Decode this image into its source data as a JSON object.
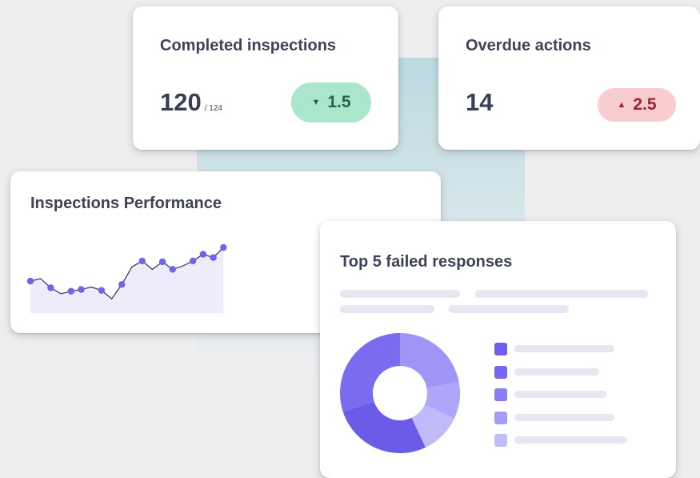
{
  "cards": {
    "completed": {
      "title": "Completed inspections",
      "value": "120",
      "total": "/ 124",
      "delta": "1.5",
      "delta_direction": "down",
      "delta_color": "#a9e6cb"
    },
    "overdue": {
      "title": "Overdue actions",
      "value": "14",
      "delta": "2.5",
      "delta_direction": "up",
      "delta_color": "#f9ccd0"
    },
    "performance": {
      "title": "Inspections Performance"
    },
    "failed": {
      "title": "Top 5 failed responses"
    }
  },
  "icons": {
    "down": "caret-down-icon",
    "up": "caret-up-icon"
  },
  "chart_data": [
    {
      "type": "line",
      "x": [
        1,
        2,
        3,
        4,
        5,
        6,
        7,
        8,
        9,
        10,
        11,
        12,
        13,
        14,
        15,
        16,
        17,
        18,
        19,
        20
      ],
      "values": [
        38,
        41,
        30,
        23,
        26,
        28,
        31,
        27,
        17,
        34,
        55,
        62,
        52,
        61,
        52,
        56,
        62,
        70,
        66,
        78
      ],
      "ylim": [
        0,
        100
      ],
      "markers": [
        1,
        0,
        1,
        0,
        1,
        1,
        0,
        1,
        0,
        1,
        0,
        1,
        0,
        1,
        1,
        0,
        1,
        1,
        1,
        1
      ],
      "line_color": "#3c3f5a",
      "marker_color": "#6f63e6",
      "fill_color": "#eeecfb",
      "grid": false
    },
    {
      "type": "pie",
      "donut": true,
      "values": [
        22,
        10,
        11,
        27,
        30
      ],
      "colors": [
        "#9f95f7",
        "#aea6f8",
        "#c0baf9",
        "#6b5ce8",
        "#7a6cf0"
      ],
      "legend_colors": [
        "#6d5ef0",
        "#7667ef",
        "#8a7df3",
        "#a59cf6",
        "#c2bcfa"
      ],
      "legend_position": "right"
    }
  ]
}
